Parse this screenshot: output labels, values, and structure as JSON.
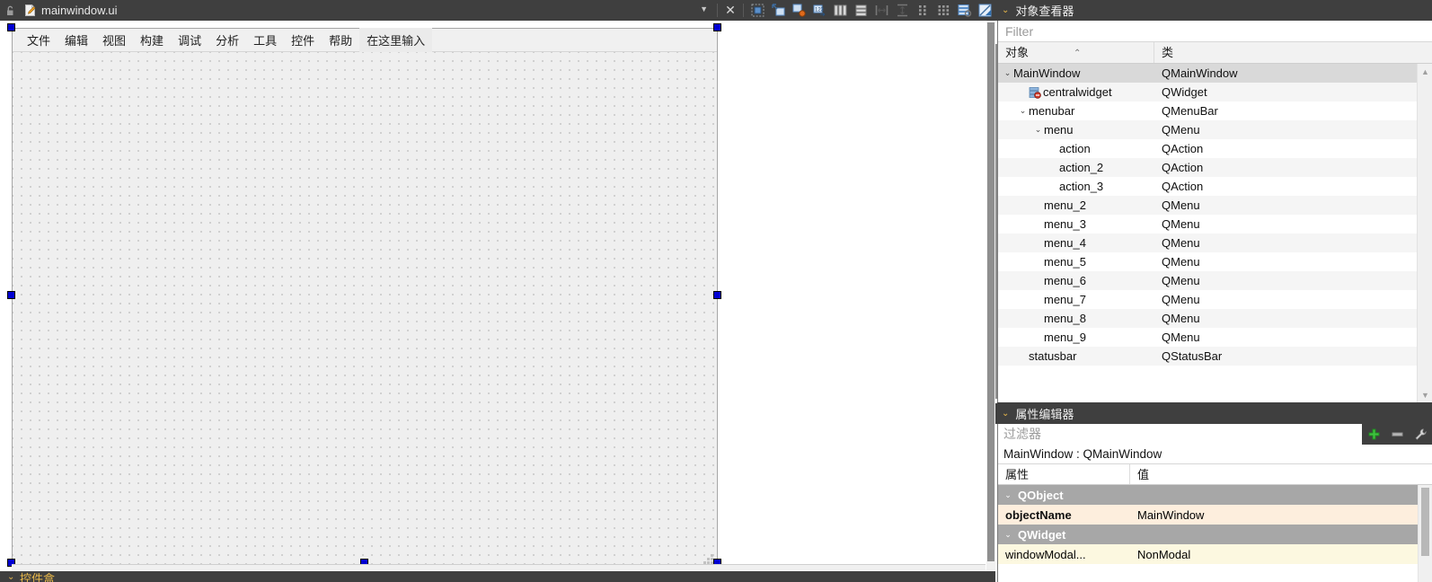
{
  "filebar": {
    "lock_icon": "unlocked-padlock-icon",
    "file_icon": "ui-document-icon",
    "filename": "mainwindow.ui",
    "dropdown_caret": "▼",
    "close_label": "✕",
    "toolbar_buttons": [
      {
        "name": "break-layout-icon",
        "tip": "Break Layout"
      },
      {
        "name": "adjust-size-icon",
        "tip": "Adjust Size"
      },
      {
        "name": "edit-signals-slots-icon",
        "tip": "Edit Signals/Slots"
      },
      {
        "name": "edit-buddies-icon",
        "tip": "Edit Buddies"
      },
      {
        "name": "layout-horizontally-icon",
        "tip": "Lay Out Horizontally"
      },
      {
        "name": "layout-vertically-icon",
        "tip": "Lay Out Vertically"
      },
      {
        "name": "layout-horizontal-splitter-icon",
        "tip": "Lay Out Horizontally in Splitter"
      },
      {
        "name": "layout-vertical-splitter-icon",
        "tip": "Lay Out Vertically in Splitter"
      },
      {
        "name": "layout-form-icon",
        "tip": "Lay Out in a Form Layout"
      },
      {
        "name": "layout-grid-icon",
        "tip": "Lay Out in a Grid"
      },
      {
        "name": "break-layout-2-icon",
        "tip": "Break Layout"
      },
      {
        "name": "adjust-size-2-icon",
        "tip": "Adjust Size"
      }
    ]
  },
  "form": {
    "menus": [
      {
        "label": "文件",
        "selected": false
      },
      {
        "label": "编辑",
        "selected": false
      },
      {
        "label": "视图",
        "selected": false
      },
      {
        "label": "构建",
        "selected": false
      },
      {
        "label": "调试",
        "selected": false
      },
      {
        "label": "分析",
        "selected": false
      },
      {
        "label": "工具",
        "selected": false
      },
      {
        "label": "控件",
        "selected": false
      },
      {
        "label": "帮助",
        "selected": false
      },
      {
        "label": "在这里输入",
        "selected": true
      }
    ],
    "selection_handles": 8,
    "size_grip": "size-grip-icon"
  },
  "bottom_dock": {
    "chevron": "⌄",
    "title": "控件盒"
  },
  "object_inspector": {
    "chevron": "⌄",
    "title": "对象查看器",
    "filter_placeholder": "Filter",
    "filter_value": "",
    "columns": [
      "对象",
      "类"
    ],
    "sort_indicator": "⌃",
    "rows": [
      {
        "indent": 0,
        "twisty": "⌄",
        "icon": "",
        "object": "MainWindow",
        "class": "QMainWindow",
        "selected": true
      },
      {
        "indent": 1,
        "twisty": "",
        "icon": "widget-disabled-icon",
        "object": "centralwidget",
        "class": "QWidget",
        "selected": false
      },
      {
        "indent": 1,
        "twisty": "⌄",
        "icon": "",
        "object": "menubar",
        "class": "QMenuBar",
        "selected": false
      },
      {
        "indent": 2,
        "twisty": "⌄",
        "icon": "",
        "object": "menu",
        "class": "QMenu",
        "selected": false
      },
      {
        "indent": 3,
        "twisty": "",
        "icon": "",
        "object": "action",
        "class": "QAction",
        "selected": false
      },
      {
        "indent": 3,
        "twisty": "",
        "icon": "",
        "object": "action_2",
        "class": "QAction",
        "selected": false
      },
      {
        "indent": 3,
        "twisty": "",
        "icon": "",
        "object": "action_3",
        "class": "QAction",
        "selected": false
      },
      {
        "indent": 2,
        "twisty": "",
        "icon": "",
        "object": "menu_2",
        "class": "QMenu",
        "selected": false
      },
      {
        "indent": 2,
        "twisty": "",
        "icon": "",
        "object": "menu_3",
        "class": "QMenu",
        "selected": false
      },
      {
        "indent": 2,
        "twisty": "",
        "icon": "",
        "object": "menu_4",
        "class": "QMenu",
        "selected": false
      },
      {
        "indent": 2,
        "twisty": "",
        "icon": "",
        "object": "menu_5",
        "class": "QMenu",
        "selected": false
      },
      {
        "indent": 2,
        "twisty": "",
        "icon": "",
        "object": "menu_6",
        "class": "QMenu",
        "selected": false
      },
      {
        "indent": 2,
        "twisty": "",
        "icon": "",
        "object": "menu_7",
        "class": "QMenu",
        "selected": false
      },
      {
        "indent": 2,
        "twisty": "",
        "icon": "",
        "object": "menu_8",
        "class": "QMenu",
        "selected": false
      },
      {
        "indent": 2,
        "twisty": "",
        "icon": "",
        "object": "menu_9",
        "class": "QMenu",
        "selected": false
      },
      {
        "indent": 1,
        "twisty": "",
        "icon": "",
        "object": "statusbar",
        "class": "QStatusBar",
        "selected": false
      }
    ],
    "scroll_up": "▲",
    "scroll_down": "▼"
  },
  "property_editor": {
    "chevron": "⌄",
    "title": "属性编辑器",
    "filter_placeholder": "过滤器",
    "filter_value": "",
    "tools": [
      {
        "name": "add-property-button",
        "glyph": "+"
      },
      {
        "name": "remove-property-button",
        "glyph": "–"
      },
      {
        "name": "configure-button",
        "glyph": "wrench-icon"
      }
    ],
    "object_line": "MainWindow : QMainWindow",
    "columns": [
      "属性",
      "值"
    ],
    "rows": [
      {
        "type": "group",
        "chevron": "⌄",
        "key": "QObject",
        "value": ""
      },
      {
        "type": "prop",
        "style": "name",
        "key": "objectName",
        "value": "MainWindow"
      },
      {
        "type": "group",
        "chevron": "⌄",
        "key": "QWidget",
        "value": ""
      },
      {
        "type": "prop",
        "style": "modal",
        "key": "windowModal...",
        "value": "NonModal"
      }
    ]
  },
  "colors": {
    "chrome_dark": "#3f3f3f",
    "dock_title": "#e9b84a",
    "selection_handle": "#0000d2",
    "group_row": "#a7a7a7",
    "name_row": "#fdeedd",
    "modal_row": "#fcf8e0",
    "canvas": "#efefef"
  }
}
